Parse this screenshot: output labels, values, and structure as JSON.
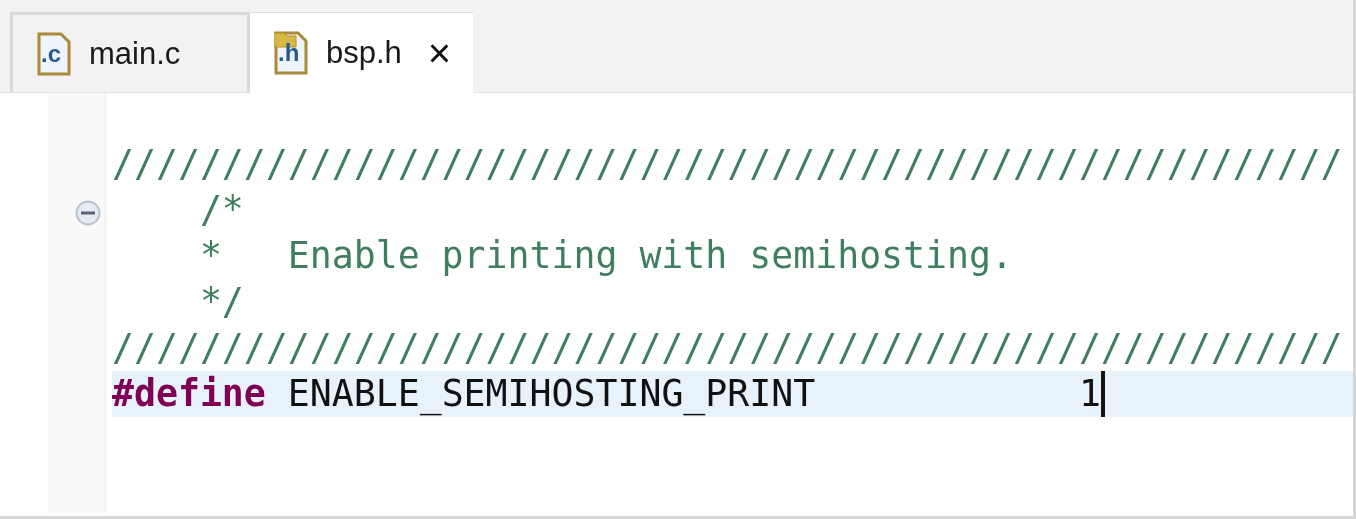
{
  "tabs": [
    {
      "label": "main.c",
      "icon_text": ".c",
      "kind": "source",
      "selected": false,
      "closable": false
    },
    {
      "label": "bsp.h",
      "icon_text": ".h",
      "kind": "header",
      "selected": true,
      "closable": true
    }
  ],
  "close_glyph": "×",
  "lines": [
    {
      "current": false,
      "tokens": [
        {
          "kind": "comment",
          "text": "////////////////////////////////////////////////////////"
        }
      ]
    },
    {
      "current": false,
      "fold": {
        "expanded": true
      },
      "tokens": [
        {
          "kind": "comment",
          "text": "    /*"
        }
      ]
    },
    {
      "current": false,
      "tokens": [
        {
          "kind": "comment",
          "text": "    *   Enable printing with semihosting."
        }
      ]
    },
    {
      "current": false,
      "tokens": [
        {
          "kind": "comment",
          "text": "    */"
        }
      ]
    },
    {
      "current": false,
      "tokens": [
        {
          "kind": "comment",
          "text": "////////////////////////////////////////////////////////"
        }
      ]
    },
    {
      "current": true,
      "tokens": [
        {
          "kind": "keyword",
          "text": "#define"
        },
        {
          "kind": "plain",
          "text": " ENABLE_SEMIHOSTING_PRINT            "
        },
        {
          "kind": "number",
          "text": "1"
        }
      ]
    }
  ]
}
